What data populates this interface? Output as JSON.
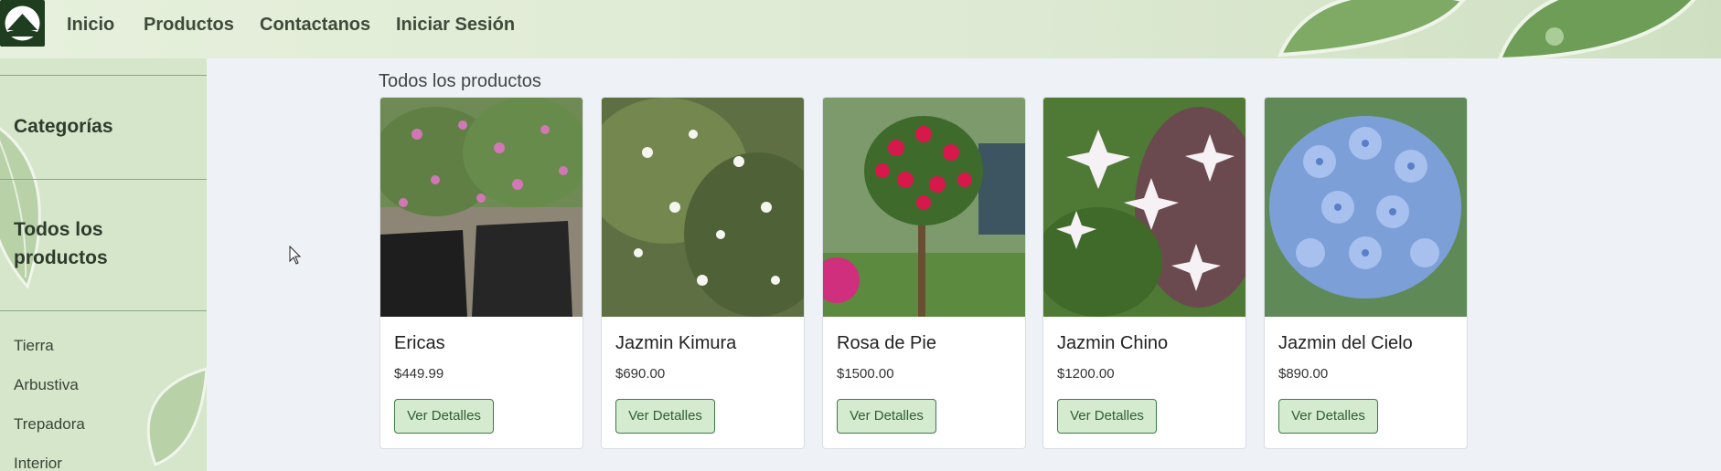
{
  "nav": {
    "links": [
      "Inicio",
      "Productos",
      "Contactanos",
      "Iniciar Sesión"
    ]
  },
  "sidebar": {
    "heading_categories": "Categorías",
    "heading_all": "Todos los productos",
    "items": [
      "Tierra",
      "Arbustiva",
      "Trepadora",
      "Interior"
    ]
  },
  "main": {
    "title": "Todos los productos",
    "button_label": "Ver Detalles",
    "products": [
      {
        "name": "Ericas",
        "price": "$449.99"
      },
      {
        "name": "Jazmin Kimura",
        "price": "$690.00"
      },
      {
        "name": "Rosa de Pie",
        "price": "$1500.00"
      },
      {
        "name": "Jazmin Chino",
        "price": "$1200.00"
      },
      {
        "name": "Jazmin del Cielo",
        "price": "$890.00"
      }
    ]
  },
  "colors": {
    "accent_green": "#3f7a45",
    "button_bg": "#d4ebcf",
    "sidebar_bg": "#d6e6ca"
  }
}
